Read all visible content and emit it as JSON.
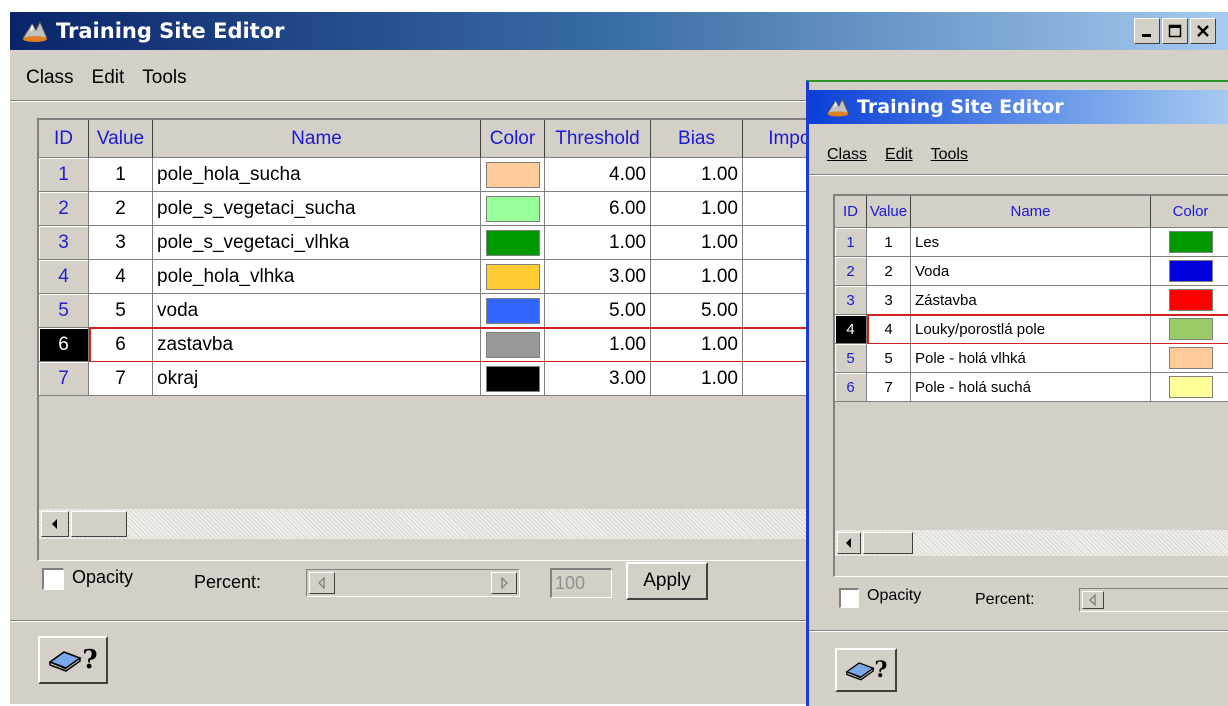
{
  "main": {
    "title": "Training Site Editor",
    "menu": [
      "Class",
      "Edit",
      "Tools"
    ],
    "columns": [
      "ID",
      "Value",
      "Name",
      "Color",
      "Threshold",
      "Bias",
      "Impor"
    ],
    "rows": [
      {
        "id": "1",
        "value": "1",
        "name": "pole_hola_sucha",
        "color": "#ffcc99",
        "threshold": "4.00",
        "bias": "1.00"
      },
      {
        "id": "2",
        "value": "2",
        "name": "pole_s_vegetaci_sucha",
        "color": "#99ff99",
        "threshold": "6.00",
        "bias": "1.00"
      },
      {
        "id": "3",
        "value": "3",
        "name": "pole_s_vegetaci_vlhka",
        "color": "#009900",
        "threshold": "1.00",
        "bias": "1.00"
      },
      {
        "id": "4",
        "value": "4",
        "name": "pole_hola_vlhka",
        "color": "#ffcc33",
        "threshold": "3.00",
        "bias": "1.00"
      },
      {
        "id": "5",
        "value": "5",
        "name": "voda",
        "color": "#3366ff",
        "threshold": "5.00",
        "bias": "5.00"
      },
      {
        "id": "6",
        "value": "6",
        "name": "zastavba",
        "color": "#999999",
        "threshold": "1.00",
        "bias": "1.00"
      },
      {
        "id": "7",
        "value": "7",
        "name": "okraj",
        "color": "#000000",
        "threshold": "3.00",
        "bias": "1.00"
      }
    ],
    "selected_id": "6",
    "opacity_label": "Opacity",
    "percent_label": "Percent:",
    "percent_value": "100",
    "apply_label": "Apply",
    "help_label": "?"
  },
  "second": {
    "title": "Training Site Editor",
    "menu": [
      "Class",
      "Edit",
      "Tools"
    ],
    "columns": [
      "ID",
      "Value",
      "Name",
      "Color"
    ],
    "rows": [
      {
        "id": "1",
        "value": "1",
        "name": "Les",
        "color": "#009900"
      },
      {
        "id": "2",
        "value": "2",
        "name": "Voda",
        "color": "#0000dd"
      },
      {
        "id": "3",
        "value": "3",
        "name": "Zástavba",
        "color": "#ff0000"
      },
      {
        "id": "4",
        "value": "4",
        "name": "Louky/porostlá pole",
        "color": "#99cc66"
      },
      {
        "id": "5",
        "value": "5",
        "name": "Pole - holá vlhká",
        "color": "#ffcc99"
      },
      {
        "id": "6",
        "value": "7",
        "name": "Pole - holá suchá",
        "color": "#ffff99"
      }
    ],
    "selected_id": "4",
    "opacity_label": "Opacity",
    "percent_label": "Percent:",
    "help_label": "?"
  },
  "colors": {
    "titlebar_start": "#0a246a",
    "titlebar_end": "#a6caf0",
    "titlebar_active_start": "#0a3fd8",
    "header_text": "#1a1ad4",
    "id_text": "#2020d0",
    "selection_border": "#d02020",
    "window_bg": "#d4d0c8"
  },
  "icons": [
    "app-logo-icon",
    "minimize-icon",
    "maximize-icon",
    "close-icon",
    "scroll-left-icon",
    "scroll-right-icon",
    "help-book-icon"
  ]
}
